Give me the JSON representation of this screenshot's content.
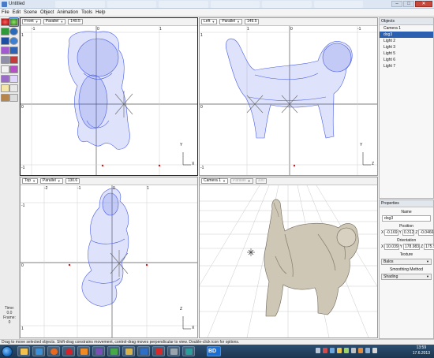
{
  "window": {
    "title": "Untitled"
  },
  "menu": [
    "File",
    "Edit",
    "Scene",
    "Object",
    "Animation",
    "Tools",
    "Help"
  ],
  "toolbox": {
    "time_label": "Time:",
    "time_value": "0.0",
    "frame_label": "Frame:",
    "frame_value": "0"
  },
  "viewports": {
    "front": {
      "view": "Front",
      "projection": "Parallel",
      "zoom": "149.5",
      "ticks_x": [
        "-1",
        "0",
        "1"
      ],
      "ticks_y": [
        "1",
        "0",
        "-1"
      ],
      "axis_a": "Y",
      "axis_b": "X"
    },
    "left": {
      "view": "Left",
      "projection": "Parallel",
      "zoom": "149.5",
      "ticks_x": [
        "1",
        "0",
        "-1"
      ],
      "ticks_y": [
        "1",
        "0",
        "-1"
      ],
      "axis_a": "Y",
      "axis_b": "Z"
    },
    "top": {
      "view": "Top",
      "projection": "Parallel",
      "zoom": "130.6",
      "ticks_x": [
        "-2",
        "-1",
        "0",
        "1"
      ],
      "ticks_y": [
        "-1",
        "0",
        "1"
      ],
      "axis_a": "Z",
      "axis_b": "X"
    },
    "camera": {
      "view": "Camera 1",
      "projection": "Parallel",
      "zoom": "100"
    }
  },
  "objects_panel": {
    "title": "Objects",
    "items": [
      "Camera 1",
      "dog3",
      "Light 2",
      "Light 3",
      "Light 5",
      "Light 6",
      "Light 7"
    ],
    "selected": 1
  },
  "properties_panel": {
    "title": "Properties",
    "name_label": "Name",
    "name_value": "dog3",
    "position_label": "Position",
    "position": {
      "x": "-0.169",
      "y": "0.312",
      "z": "-0.0466"
    },
    "orientation_label": "Orientation",
    "orientation": {
      "x": "10.039",
      "y": "178.983",
      "z": "175.918"
    },
    "texture_label": "Texture",
    "texture_value": "Balos",
    "smoothing_label": "Smoothing Method",
    "smoothing_value": "Shading"
  },
  "status_text": "Drag to move selected objects. Shift-drag constrains movement, control-drag moves perpendicular to view. Double-click icon for options.",
  "taskbar": {
    "bd_label": "BD",
    "time": "13:59",
    "date": "17.6.2013"
  },
  "colors": {
    "mesh_wire": "#4a5ee6",
    "render_surface": "#cfc7b6",
    "selection": "#2b5fb0"
  }
}
